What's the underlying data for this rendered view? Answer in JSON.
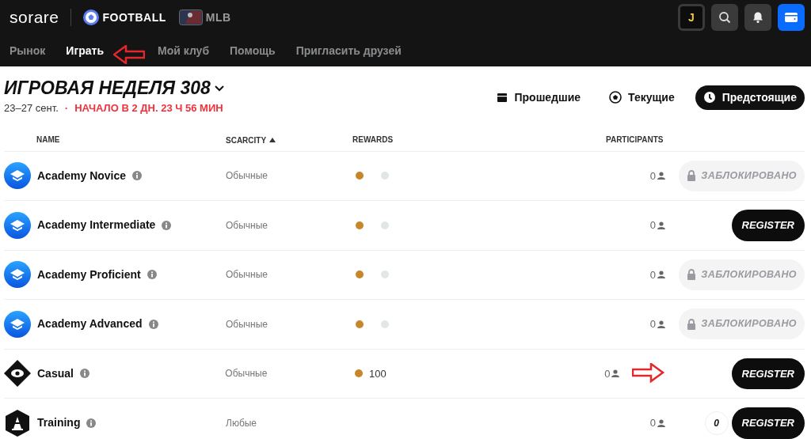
{
  "header": {
    "logo": "sorare",
    "sports": [
      {
        "label": "FOOTBALL",
        "kind": "football",
        "selected": true
      },
      {
        "label": "MLB",
        "kind": "mlb",
        "selected": false
      }
    ],
    "avatar": "J"
  },
  "nav": [
    {
      "label": "Рынок",
      "selected": false
    },
    {
      "label": "Играть",
      "selected": true,
      "annotated": true
    },
    {
      "label": "Мой клуб",
      "selected": false
    },
    {
      "label": "Помощь",
      "selected": false
    },
    {
      "label": "Пригласить друзей",
      "selected": false
    }
  ],
  "gameweek": {
    "title": "ИГРОВАЯ НЕДЕЛЯ 308",
    "dates": "23–27 сент.",
    "separator": "·",
    "countdown": "НАЧАЛО В 2 ДН. 23 Ч 56 МИН"
  },
  "filters": [
    {
      "label": "Прошедшие",
      "kind": "calendar",
      "selected": false
    },
    {
      "label": "Текущие",
      "kind": "ball",
      "selected": false
    },
    {
      "label": "Предстоящие",
      "kind": "clock",
      "selected": true
    }
  ],
  "table": {
    "columns": [
      {
        "label": "NAME",
        "sorted": false
      },
      {
        "label": "SCARCITY",
        "sorted": true
      },
      {
        "label": "REWARDS",
        "sorted": false
      },
      {
        "label": "PARTICIPANTS",
        "sorted": false
      }
    ],
    "rows": [
      {
        "name": "Academy Novice",
        "kind": "academy",
        "scarcity": "Обычные",
        "rewards": [
          {
            "color": "#c8862a"
          },
          {
            "color": "#e3e6e6"
          }
        ],
        "participants": "0",
        "action": {
          "label": "ЗАБЛОКИРОВАНО",
          "kind": "locked"
        }
      },
      {
        "name": "Academy Intermediate",
        "kind": "academy",
        "scarcity": "Обычные",
        "rewards": [
          {
            "color": "#c8862a"
          },
          {
            "color": "#e3e6e6"
          }
        ],
        "participants": "0",
        "action": {
          "label": "REGISTER",
          "kind": "register"
        }
      },
      {
        "name": "Academy Proficient",
        "kind": "academy",
        "scarcity": "Обычные",
        "rewards": [
          {
            "color": "#c8862a"
          },
          {
            "color": "#e3e6e6"
          }
        ],
        "participants": "0",
        "action": {
          "label": "ЗАБЛОКИРОВАНО",
          "kind": "locked"
        }
      },
      {
        "name": "Academy Advanced",
        "kind": "academy",
        "scarcity": "Обычные",
        "rewards": [
          {
            "color": "#c8862a"
          },
          {
            "color": "#e3e6e6"
          }
        ],
        "participants": "0",
        "action": {
          "label": "ЗАБЛОКИРОВАНО",
          "kind": "locked"
        }
      },
      {
        "name": "Casual",
        "kind": "casual",
        "scarcity": "Обычные",
        "rewards": [
          {
            "color": "#c8862a",
            "amount": "100"
          }
        ],
        "participants": "0",
        "action": {
          "label": "REGISTER",
          "kind": "register"
        },
        "annotated": true
      },
      {
        "name": "Training",
        "kind": "training",
        "scarcity": "Любые",
        "rewards": [],
        "participants": "0",
        "badge": "0",
        "action": {
          "label": "REGISTER",
          "kind": "register"
        }
      }
    ]
  }
}
